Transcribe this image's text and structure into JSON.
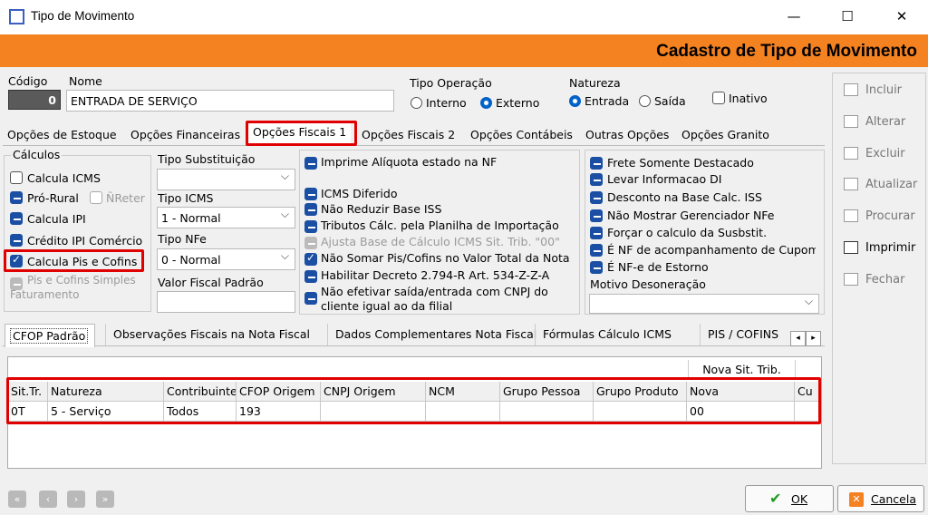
{
  "window": {
    "title": "Tipo de Movimento",
    "minimize": "—",
    "maximize": "☐",
    "close": "✕"
  },
  "banner": {
    "title": "Cadastro de Tipo de Movimento"
  },
  "header": {
    "codigo_label": "Código",
    "codigo_value": "0",
    "nome_label": "Nome",
    "nome_value": "ENTRADA DE SERVIÇO",
    "tipo_operacao_label": "Tipo Operação",
    "interno": "Interno",
    "externo": "Externo",
    "natureza_label": "Natureza",
    "entrada": "Entrada",
    "saida": "Saída",
    "inativo": "Inativo"
  },
  "tabs": [
    "Opções de Estoque",
    "Opções Financeiras",
    "Opções Fiscais 1",
    "Opções Fiscais 2",
    "Opções Contábeis",
    "Outras Opções",
    "Opções Granito"
  ],
  "calculos": {
    "title": "Cálculos",
    "icms": "Calcula ICMS",
    "pro_rural": "Pró-Rural",
    "nreter": "ÑReter",
    "ipi": "Calcula IPI",
    "credito_ipi": "Crédito IPI Comércio",
    "pis_cofins": "Calcula Pis e Cofins",
    "pis_simples_1": "Pis e Cofins Simples",
    "pis_simples_2": "Faturamento"
  },
  "fields": {
    "tipo_subst_label": "Tipo Substituição",
    "tipo_subst_value": "",
    "tipo_icms_label": "Tipo ICMS",
    "tipo_icms_value": "1 - Normal",
    "tipo_nfe_label": "Tipo NFe",
    "tipo_nfe_value": "0 - Normal",
    "valor_fiscal_label": "Valor Fiscal Padrão",
    "valor_fiscal_value": ""
  },
  "options_mid": [
    "Imprime Alíquota estado na NF",
    "ICMS Diferido",
    "Não Reduzir Base ISS",
    "Tributos Cálc. pela Planilha de Importação",
    "Ajusta Base de Cálculo ICMS Sit. Trib. \"00\"",
    "Não Somar Pis/Cofins no Valor Total da Nota",
    "Habilitar Decreto 2.794-R Art. 534-Z-Z-A",
    "Não efetivar saída/entrada com CNPJ do",
    "cliente igual ao da filial"
  ],
  "options_right": [
    "Frete Somente Destacado",
    "Levar Informacao DI",
    "Desconto na Base Calc. ISS",
    "Não Mostrar Gerenciador NFe",
    "Forçar o calculo da Susbstit.",
    "É NF de acompanhamento de Cupom",
    "É NF-e de Estorno"
  ],
  "motivo": {
    "label": "Motivo Desoneração",
    "value": ""
  },
  "bottom_tabs": [
    "CFOP Padrão",
    "Observações Fiscais na Nota Fiscal",
    "Dados Complementares Nota Fiscal",
    "Fórmulas Cálculo ICMS",
    "PIS / COFINS"
  ],
  "grid": {
    "group_header": "Nova Sit. Trib.",
    "columns": [
      "Sit.Tr.",
      "Natureza",
      "Contribuinte",
      "CFOP Origem",
      "CNPJ Origem",
      "NCM",
      "Grupo Pessoa",
      "Grupo Produto",
      "Nova",
      "Cu"
    ],
    "rows": [
      [
        "0T",
        "5 - Serviço",
        "Todos",
        "193",
        "",
        "",
        "",
        "",
        "00",
        ""
      ]
    ]
  },
  "side_buttons": [
    "Incluir",
    "Alterar",
    "Excluir",
    "Atualizar",
    "Procurar",
    "Imprimir",
    "Fechar"
  ],
  "footer": {
    "ok": "OK",
    "cancel": "Cancela"
  },
  "colors": {
    "banner": "#f58220",
    "highlight": "#e00000",
    "check": "#1a4fa3"
  }
}
